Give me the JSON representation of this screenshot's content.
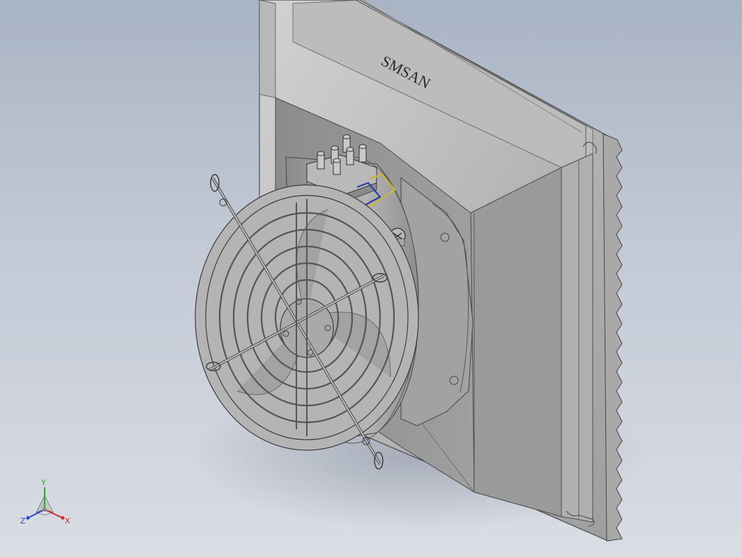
{
  "viewport": {
    "background_top": "#a9b4c4",
    "background_bottom": "#d9dde4"
  },
  "model": {
    "brand_text": "SMSAN",
    "description": "",
    "colors": {
      "body": "#9c9c9c",
      "body_light": "#c8c8c8",
      "body_dark": "#6e6e6e",
      "edge": "#3a3a3a",
      "wire_blue": "#2b3ca8",
      "wire_yellow": "#c8b830"
    }
  },
  "triad": {
    "x_label": "X",
    "y_label": "Y",
    "z_label": "Z",
    "x_color": "#d22a2a",
    "y_color": "#2aa82a",
    "z_color": "#2a46c8"
  }
}
